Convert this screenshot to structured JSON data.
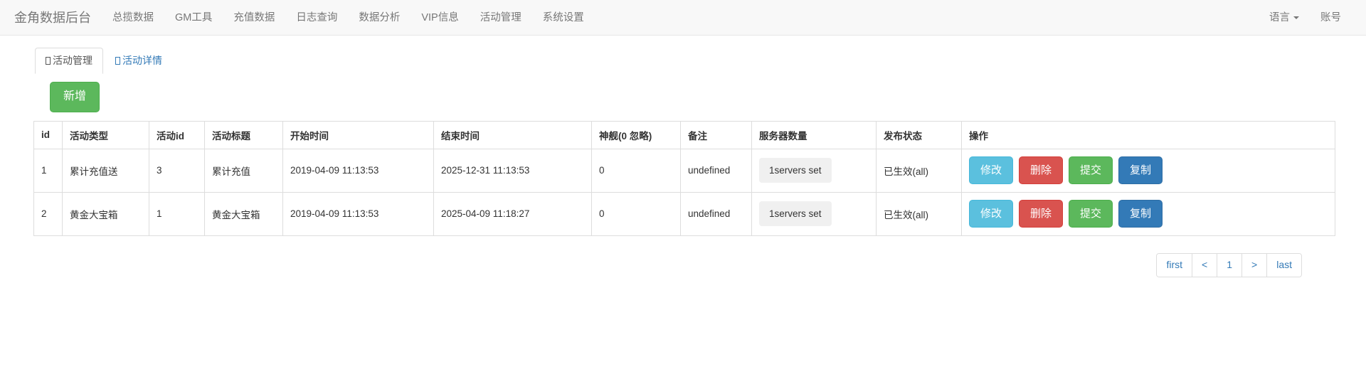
{
  "navbar": {
    "brand": "金角数据后台",
    "items": [
      {
        "label": "总揽数据"
      },
      {
        "label": "GM工具"
      },
      {
        "label": "充值数据"
      },
      {
        "label": "日志查询"
      },
      {
        "label": "数据分析"
      },
      {
        "label": "VIP信息"
      },
      {
        "label": "活动管理"
      },
      {
        "label": "系统设置"
      }
    ],
    "right": [
      {
        "label": "语言",
        "caret": true
      },
      {
        "label": "账号",
        "caret": false
      }
    ]
  },
  "tabs": [
    {
      "label": "活动管理",
      "active": true
    },
    {
      "label": "活动详情",
      "active": false
    }
  ],
  "toolbar": {
    "add_label": "新增"
  },
  "table": {
    "headers": [
      "id",
      "活动类型",
      "活动id",
      "活动标题",
      "开始时间",
      "结束时间",
      "神舰(0 忽略)",
      "备注",
      "服务器数量",
      "发布状态",
      "操作"
    ],
    "rows": [
      {
        "id": "1",
        "type": "累计充值送",
        "activity_id": "3",
        "title": "累计充值",
        "start_time": "2019-04-09 11:13:53",
        "end_time": "2025-12-31 11:13:53",
        "ship": "0",
        "remark": "undefined",
        "servers": "1servers set",
        "status": "已生效(all)",
        "ops": [
          {
            "label": "修改",
            "style": "info"
          },
          {
            "label": "删除",
            "style": "danger"
          },
          {
            "label": "提交",
            "style": "success"
          },
          {
            "label": "复制",
            "style": "primary"
          }
        ]
      },
      {
        "id": "2",
        "type": "黄金大宝箱",
        "activity_id": "1",
        "title": "黄金大宝箱",
        "start_time": "2019-04-09 11:13:53",
        "end_time": "2025-04-09 11:18:27",
        "ship": "0",
        "remark": "undefined",
        "servers": "1servers set",
        "status": "已生效(all)",
        "ops": [
          {
            "label": "修改",
            "style": "info"
          },
          {
            "label": "删除",
            "style": "danger"
          },
          {
            "label": "提交",
            "style": "success"
          },
          {
            "label": "复制",
            "style": "primary"
          }
        ]
      }
    ]
  },
  "pagination": {
    "items": [
      {
        "label": "first",
        "name": "first"
      },
      {
        "label": "<",
        "name": "prev"
      },
      {
        "label": "1",
        "name": "page-1"
      },
      {
        "label": ">",
        "name": "next"
      },
      {
        "label": "last",
        "name": "last"
      }
    ]
  },
  "colors": {
    "navbar_bg": "#f8f8f8",
    "accent_primary": "#337ab7",
    "accent_success": "#5cb85c",
    "accent_danger": "#d9534f",
    "accent_info": "#5bc0de",
    "border": "#dddddd"
  }
}
